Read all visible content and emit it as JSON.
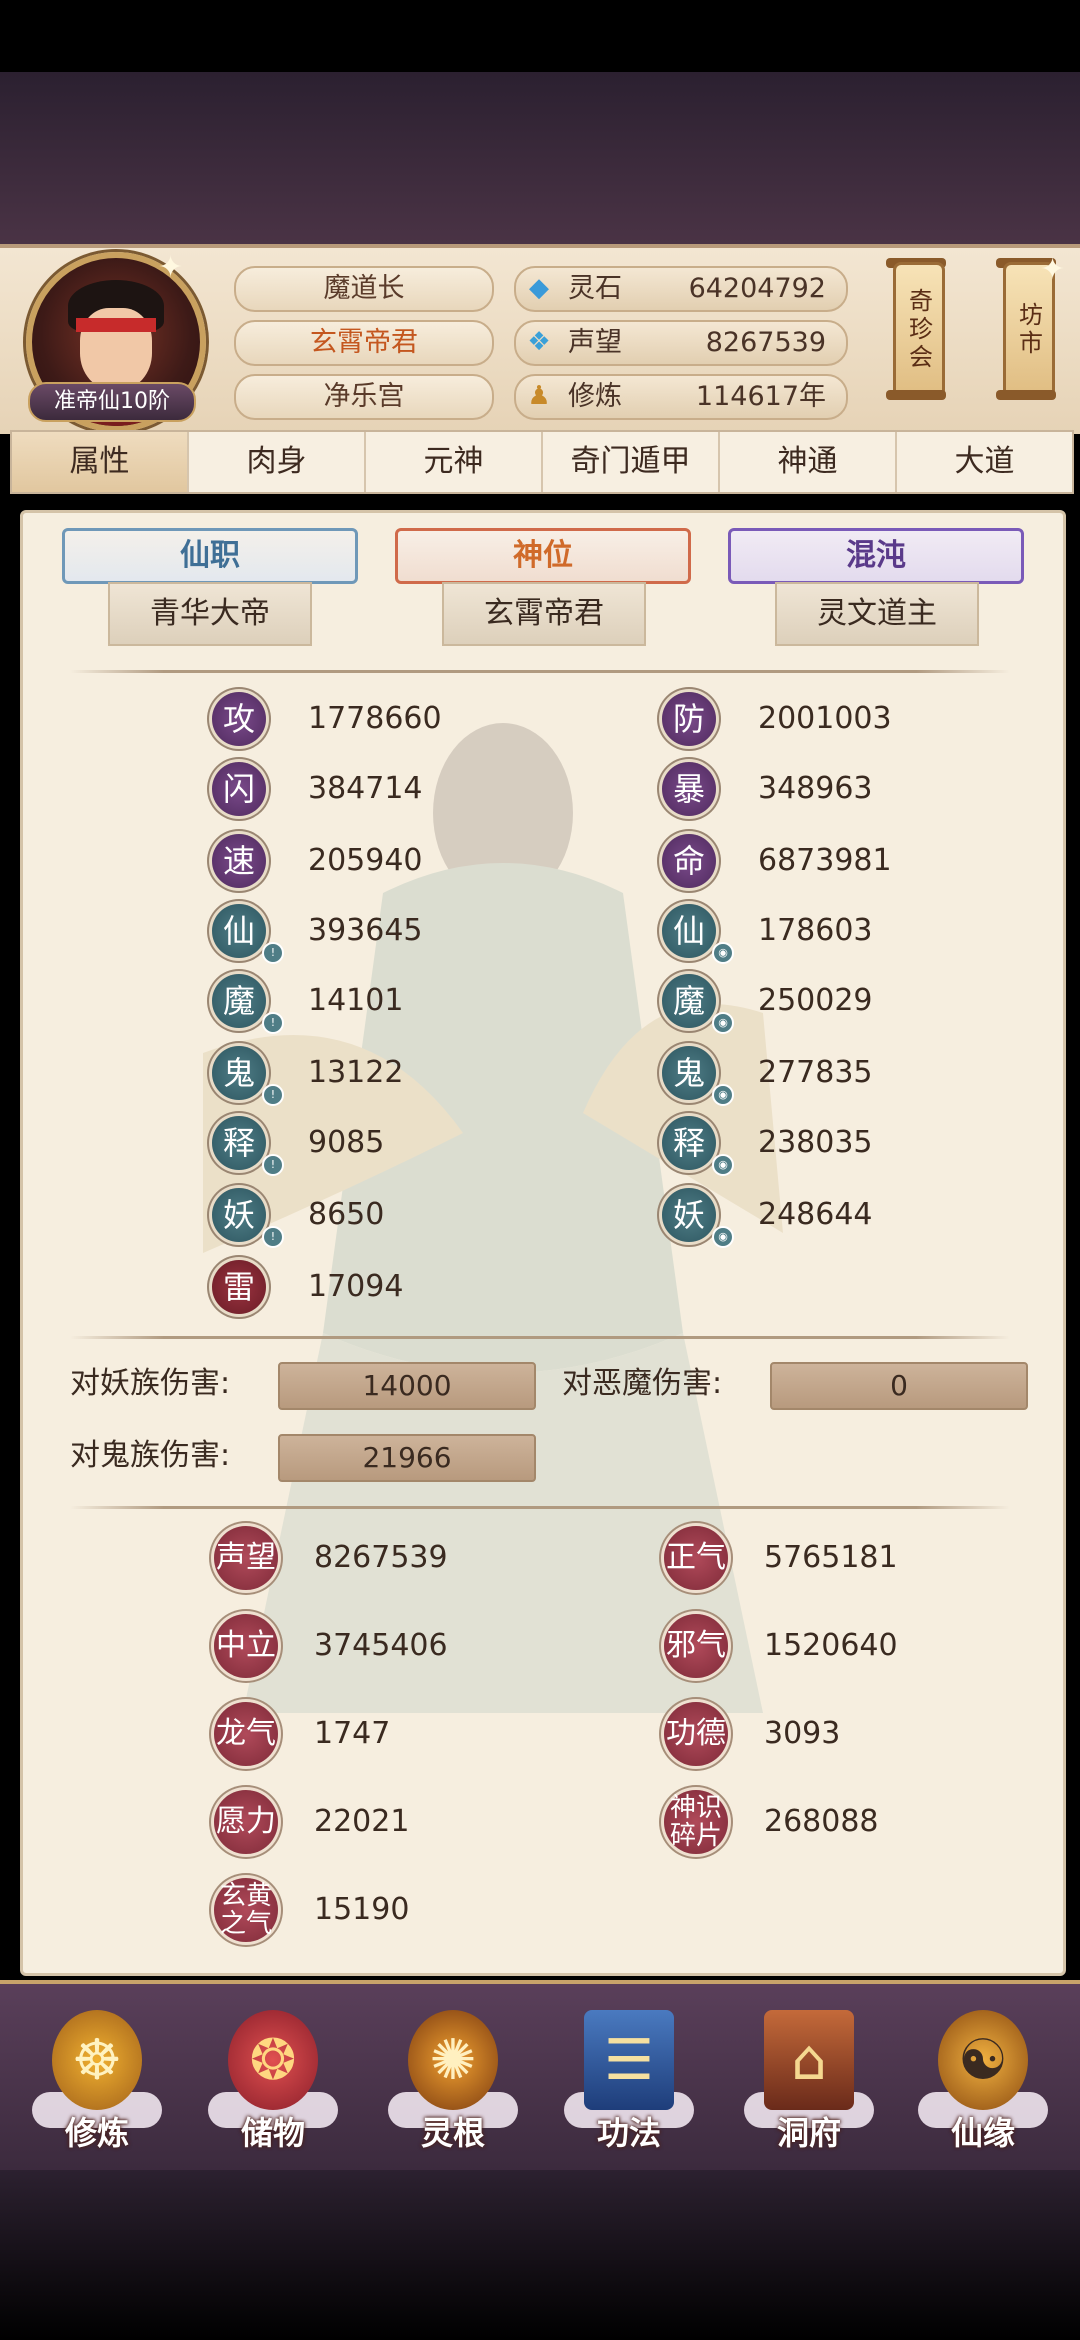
{
  "player": {
    "level": "准帝仙10阶",
    "title": "魔道长",
    "deity_title": "玄霄帝君",
    "sect": "净乐宫"
  },
  "resources": [
    {
      "icon": "spirit-stone-icon",
      "label": "灵石",
      "value": "64204792"
    },
    {
      "icon": "reputation-icon",
      "label": "声望",
      "value": "8267539"
    },
    {
      "icon": "cultivation-icon",
      "label": "修炼",
      "value": "114617年"
    }
  ],
  "side_buttons": {
    "treasure_fair": "奇珍会",
    "market": "坊市"
  },
  "tabs": [
    "属性",
    "肉身",
    "元神",
    "奇门遁甲",
    "神通",
    "大道"
  ],
  "ranks": [
    {
      "tag": "仙职",
      "name": "青华大帝",
      "color": "#3f6f96"
    },
    {
      "tag": "神位",
      "name": "玄霄帝君",
      "color": "#d06a2a"
    },
    {
      "tag": "混沌",
      "name": "灵文道主",
      "color": "#5a3a8a"
    }
  ],
  "stats_left": [
    {
      "glyph": "攻",
      "value": "1778660",
      "type": "purple"
    },
    {
      "glyph": "闪",
      "value": "384714",
      "type": "purple"
    },
    {
      "glyph": "速",
      "value": "205940",
      "type": "purple"
    },
    {
      "glyph": "仙",
      "value": "393645",
      "type": "teal"
    },
    {
      "glyph": "魔",
      "value": "14101",
      "type": "teal"
    },
    {
      "glyph": "鬼",
      "value": "13122",
      "type": "teal"
    },
    {
      "glyph": "释",
      "value": "9085",
      "type": "teal"
    },
    {
      "glyph": "妖",
      "value": "8650",
      "type": "teal"
    },
    {
      "glyph": "雷",
      "value": "17094",
      "type": "red"
    }
  ],
  "stats_right": [
    {
      "glyph": "防",
      "value": "2001003",
      "type": "purple"
    },
    {
      "glyph": "暴",
      "value": "348963",
      "type": "purple"
    },
    {
      "glyph": "命",
      "value": "6873981",
      "type": "purple"
    },
    {
      "glyph": "仙",
      "value": "178603",
      "type": "teal"
    },
    {
      "glyph": "魔",
      "value": "250029",
      "type": "teal"
    },
    {
      "glyph": "鬼",
      "value": "277835",
      "type": "teal"
    },
    {
      "glyph": "释",
      "value": "238035",
      "type": "teal"
    },
    {
      "glyph": "妖",
      "value": "248644",
      "type": "teal"
    }
  ],
  "damage": {
    "vs_demon_race_label": "对妖族伤害:",
    "vs_demon_race_value": "14000",
    "vs_evil_demon_label": "对恶魔伤害:",
    "vs_evil_demon_value": "0",
    "vs_ghost_label": "对鬼族伤害:",
    "vs_ghost_value": "21966"
  },
  "reputation_left": [
    {
      "glyph": "声望",
      "value": "8267539"
    },
    {
      "glyph": "中立",
      "value": "3745406"
    },
    {
      "glyph": "龙气",
      "value": "1747"
    },
    {
      "glyph": "愿力",
      "value": "22021"
    },
    {
      "glyph": "玄黄之气",
      "value": "15190"
    }
  ],
  "reputation_right": [
    {
      "glyph": "正气",
      "value": "5765181"
    },
    {
      "glyph": "邪气",
      "value": "1520640"
    },
    {
      "glyph": "功德",
      "value": "3093"
    },
    {
      "glyph": "神识碎片",
      "value": "268088"
    }
  ],
  "bottom_nav": [
    {
      "label": "修炼",
      "icon": "cultivate-icon"
    },
    {
      "label": "储物",
      "icon": "storage-bag-icon"
    },
    {
      "label": "灵根",
      "icon": "spirit-root-icon"
    },
    {
      "label": "功法",
      "icon": "technique-book-icon"
    },
    {
      "label": "洞府",
      "icon": "cave-dwelling-icon"
    },
    {
      "label": "仙缘",
      "icon": "gourd-icon"
    }
  ]
}
